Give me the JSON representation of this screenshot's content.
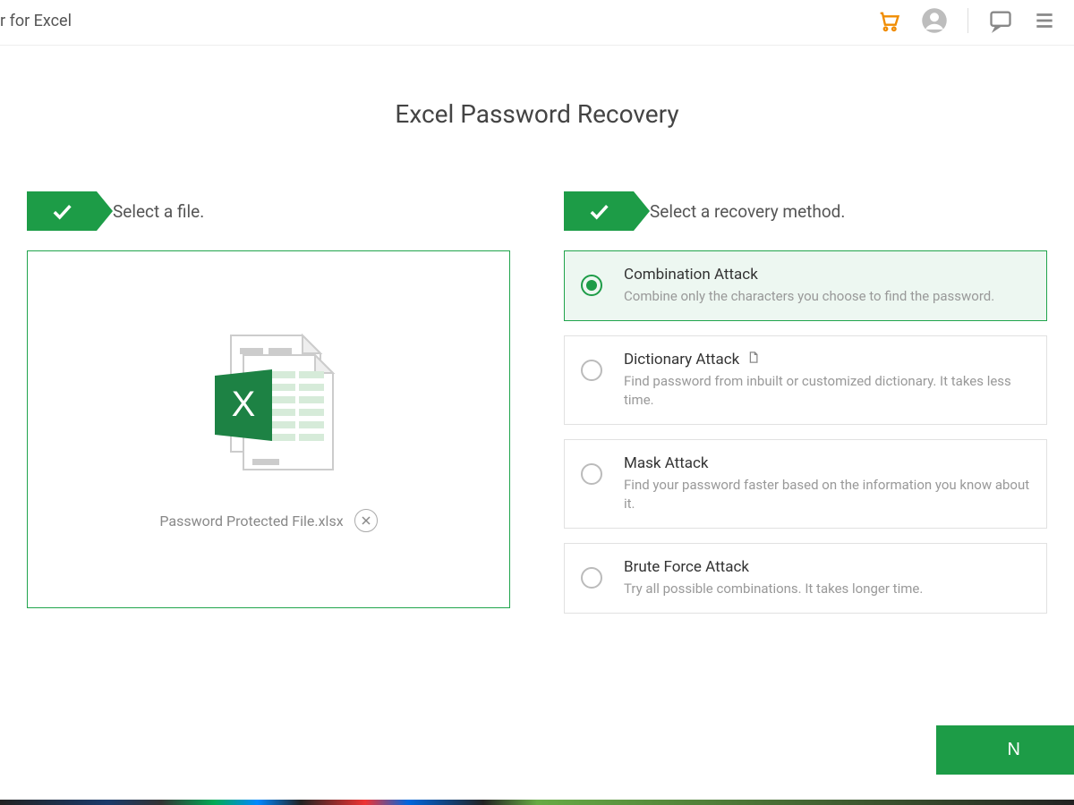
{
  "header": {
    "app_title_fragment": "r for Excel"
  },
  "page": {
    "title": "Excel Password Recovery"
  },
  "step1": {
    "label": "Select a file.",
    "file_name": "Password Protected File.xlsx"
  },
  "step2": {
    "label": "Select a recovery method.",
    "methods": [
      {
        "title": "Combination Attack",
        "desc": "Combine only the characters you choose to find the password.",
        "selected": true
      },
      {
        "title": "Dictionary Attack",
        "desc": "Find password from inbuilt or customized dictionary. It takes less time.",
        "has_info_icon": true
      },
      {
        "title": "Mask Attack",
        "desc": "Find your password faster based on the information you know about it."
      },
      {
        "title": "Brute Force Attack",
        "desc": "Try all possible combinations. It takes longer time."
      }
    ]
  },
  "footer": {
    "next_label_fragment": "N"
  },
  "colors": {
    "brand_green": "#1d9c47",
    "cart_orange": "#f08c00"
  }
}
